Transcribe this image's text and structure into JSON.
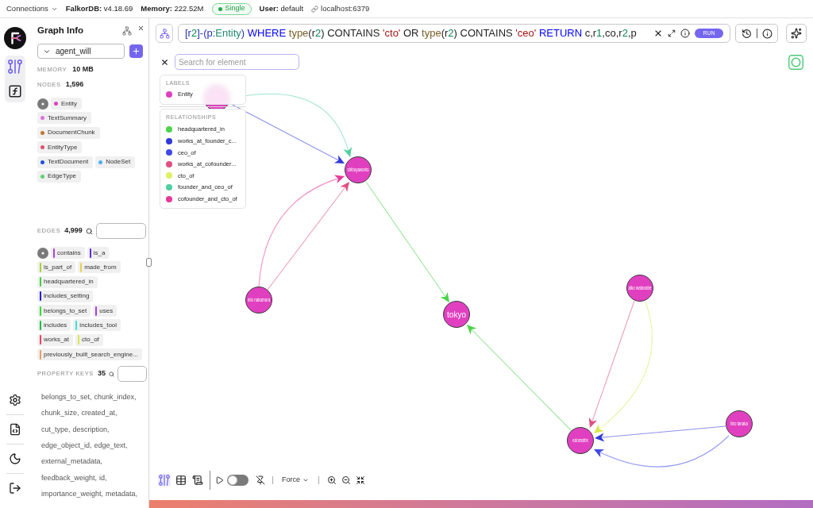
{
  "top_bar": {
    "connections": "Connections",
    "version": "**FalkorDB:** v4.18.69",
    "memory": "**Memory:** 222.52M",
    "mode": "Single",
    "user": "**User:** default",
    "host": "localhost:6379"
  },
  "rail": {
    "items": [
      {
        "kind": "graph",
        "selected": true
      },
      {
        "kind": "functions",
        "selected": false
      }
    ]
  },
  "graph_info": {
    "title": "Graph Info",
    "graph": "agent_will",
    "memory": {
      "label": "MEMORY",
      "value": "10 MB"
    },
    "nodes": {
      "label": "NODES",
      "value": "1,596"
    },
    "labels": [
      {
        "name": "Entity",
        "color": "#e040c0"
      },
      {
        "name": "TextSummary",
        "color": "#e070e0"
      },
      {
        "name": "DocumentChunk",
        "color": "#c07830"
      },
      {
        "name": "EntityType",
        "color": "#e05070"
      },
      {
        "name": "TextDocument",
        "color": "#2050e0"
      },
      {
        "name": "NodeSet",
        "color": "#50b0f0"
      },
      {
        "name": "EdgeType",
        "color": "#60d070"
      }
    ],
    "edges": {
      "label": "EDGES",
      "value": "4,999"
    },
    "edge_types": [
      {
        "name": "contains",
        "color": "#b040e8"
      },
      {
        "name": "is_a",
        "color": "#5a2ee0"
      },
      {
        "name": "is_part_of",
        "color": "#a8d42a"
      },
      {
        "name": "made_from",
        "color": "#e8d050"
      },
      {
        "name": "headquartered_in",
        "color": "#40d040"
      },
      {
        "name": "includes_setting",
        "color": "#2020d0"
      },
      {
        "name": "belongs_to_set",
        "color": "#30e030"
      },
      {
        "name": "uses",
        "color": "#a040f0"
      },
      {
        "name": "includes",
        "color": "#20c040"
      },
      {
        "name": "includes_tool",
        "color": "#40e0d0"
      },
      {
        "name": "works_at",
        "color": "#f04060"
      },
      {
        "name": "cto_of",
        "color": "#d8e850"
      },
      {
        "name": "previously_built_search_engine...",
        "color": "#e8a060"
      }
    ],
    "property_keys": {
      "label": "PROPERTY KEYS",
      "value": "35",
      "items": [
        "belongs_to_set,",
        "chunk_index,",
        "chunk_size,",
        "created_at,",
        "cut_type,",
        "description,",
        "edge_object_id,",
        "edge_text,",
        "external_metadata,",
        "feedback_weight,",
        "id,",
        "importance_weight,",
        "metadata,"
      ]
    }
  },
  "query": {
    "tokens": [
      {
        "text": "[r",
        "kind": "pattern"
      },
      {
        "text": "2",
        "kind": "number"
      },
      {
        "text": "]-(p:",
        "kind": "pattern"
      },
      {
        "text": "Entity",
        "kind": "label"
      },
      {
        "text": ") ",
        "kind": "pattern"
      },
      {
        "text": "WHERE ",
        "kind": "keyword"
      },
      {
        "text": "type",
        "kind": "function"
      },
      {
        "text": "(r",
        "kind": "text"
      },
      {
        "text": "2",
        "kind": "number"
      },
      {
        "text": ") CONTAINS ",
        "kind": "text"
      },
      {
        "text": "'cto'",
        "kind": "string"
      },
      {
        "text": " OR ",
        "kind": "text"
      },
      {
        "text": "type",
        "kind": "function"
      },
      {
        "text": "(r",
        "kind": "text"
      },
      {
        "text": "2",
        "kind": "number"
      },
      {
        "text": ") CONTAINS ",
        "kind": "text"
      },
      {
        "text": "'ceo'",
        "kind": "string"
      },
      {
        "text": " RETURN ",
        "kind": "keyword"
      },
      {
        "text": "c,r",
        "kind": "text"
      },
      {
        "text": "1",
        "kind": "number"
      },
      {
        "text": ",co,r",
        "kind": "text"
      },
      {
        "text": "2",
        "kind": "number"
      },
      {
        "text": ",p",
        "kind": "text"
      }
    ],
    "run": "RUN"
  },
  "search": {
    "placeholder": "Search for element"
  },
  "legend": {
    "labels_title": "LABELS",
    "labels": [
      {
        "name": "Entity",
        "color": "#e040c0"
      }
    ],
    "relationships_title": "RELATIONSHIPS",
    "relationships": [
      {
        "name": "headquartered_in",
        "color": "#4cd44c"
      },
      {
        "name": "works_at_founder_c...",
        "color": "#3038d8"
      },
      {
        "name": "ceo_of",
        "color": "#4048e8"
      },
      {
        "name": "works_at_cofounder...",
        "color": "#e05080"
      },
      {
        "name": "cto_of",
        "color": "#e0f060"
      },
      {
        "name": "founder_and_ceo_of",
        "color": "#50d0a0"
      },
      {
        "name": "cofounder_and_cto_of",
        "color": "#e83898"
      }
    ]
  },
  "graph": {
    "nodes": [
      {
        "color": "#e040c0"
      },
      {
        "label": "shibuyaworks",
        "color": "#e040c0"
      },
      {
        "label": "mio nakamura",
        "color": "#e040c0"
      },
      {
        "label": "tokyo",
        "color": "#e040c0"
      },
      {
        "label": "aiko watanabe",
        "color": "#e040c0"
      },
      {
        "label": "edomatrix",
        "color": "#e040c0"
      },
      {
        "label": "hiro tanaka",
        "color": "#e040c0"
      }
    ],
    "edges": [
      {
        "color": "#50d0a0"
      },
      {
        "color": "#3038d8"
      },
      {
        "color": "#e83898"
      },
      {
        "color": "#e05080"
      },
      {
        "color": "#4cd44c"
      },
      {
        "color": "#4cd44c"
      },
      {
        "color": "#e05080"
      },
      {
        "color": "#d8e850"
      },
      {
        "color": "#3038d8"
      },
      {
        "color": "#4048e8"
      }
    ]
  },
  "toolbar": {
    "views": [
      {
        "kind": "graph",
        "selected": true
      },
      {
        "kind": "table",
        "selected": false
      },
      {
        "kind": "text",
        "selected": false
      }
    ],
    "toggle": {
      "on": false
    },
    "layout": "Force"
  }
}
